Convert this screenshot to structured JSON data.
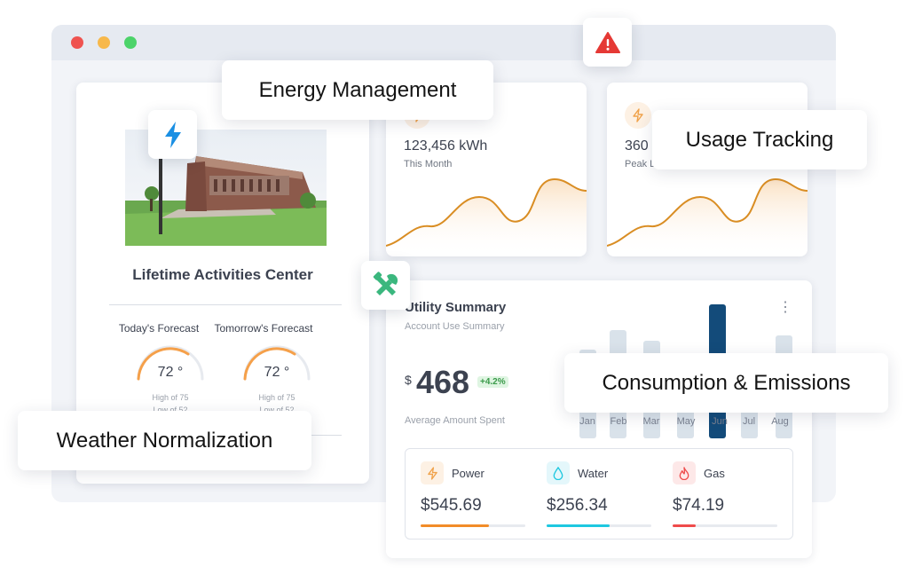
{
  "labels": {
    "energy_management": "Energy Management",
    "usage_tracking": "Usage Tracking",
    "consumption_emissions": "Consumption & Emissions",
    "weather_normalization": "Weather Normalization"
  },
  "building": {
    "name": "Lifetime Activities Center",
    "forecasts": [
      {
        "title": "Today's Forecast",
        "temp": "72 °",
        "high": "High of 75",
        "low": "Low of 52"
      },
      {
        "title": "Tomorrow's Forecast",
        "temp": "72 °",
        "high": "High of 75",
        "low": "Low of 52"
      }
    ]
  },
  "stats": [
    {
      "value": "123,456 kWh",
      "sub": "This Month"
    },
    {
      "value": "360",
      "sub": "Peak L"
    }
  ],
  "utility": {
    "title": "Utility Summary",
    "subtitle": "Account Use Summary",
    "currency": "$",
    "amount": "468",
    "change": "+4.2%",
    "amount_label": "Average Amount Spent",
    "months": [
      "Jan",
      "Feb",
      "Mar",
      "May",
      "Jun",
      "Jul",
      "Aug"
    ],
    "costs": [
      {
        "name": "Power",
        "value": "$545.69",
        "progress": 0.65,
        "color": "#f28c28",
        "icon": "lightning-icon"
      },
      {
        "name": "Water",
        "value": "$256.34",
        "progress": 0.6,
        "color": "#1ec8e0",
        "icon": "water-drop-icon"
      },
      {
        "name": "Gas",
        "value": "$74.19",
        "progress": 0.22,
        "color": "#ef4b4b",
        "icon": "flame-icon"
      }
    ]
  },
  "colors": {
    "accent_orange": "#f28c28",
    "bar_highlight": "#134b7a",
    "bar_muted": "#d9e2ea",
    "alert_red": "#e53935",
    "lightning_blue": "#1a8fe3",
    "tools_green": "#3bb77e"
  }
}
